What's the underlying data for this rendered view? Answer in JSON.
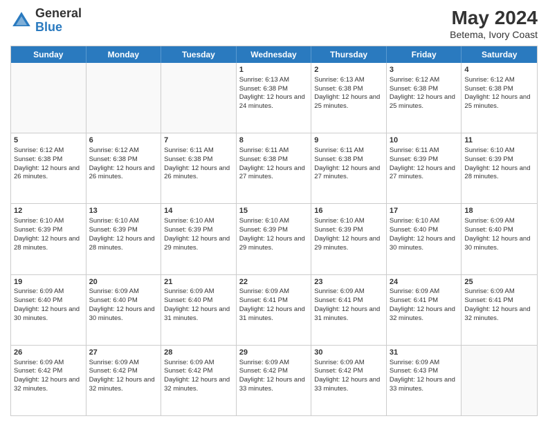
{
  "header": {
    "logo_general": "General",
    "logo_blue": "Blue",
    "month_title": "May 2024",
    "location": "Betema, Ivory Coast"
  },
  "days_of_week": [
    "Sunday",
    "Monday",
    "Tuesday",
    "Wednesday",
    "Thursday",
    "Friday",
    "Saturday"
  ],
  "weeks": [
    [
      {
        "day": "",
        "empty": true
      },
      {
        "day": "",
        "empty": true
      },
      {
        "day": "",
        "empty": true
      },
      {
        "day": "1",
        "sunrise": "Sunrise: 6:13 AM",
        "sunset": "Sunset: 6:38 PM",
        "daylight": "Daylight: 12 hours and 24 minutes."
      },
      {
        "day": "2",
        "sunrise": "Sunrise: 6:13 AM",
        "sunset": "Sunset: 6:38 PM",
        "daylight": "Daylight: 12 hours and 25 minutes."
      },
      {
        "day": "3",
        "sunrise": "Sunrise: 6:12 AM",
        "sunset": "Sunset: 6:38 PM",
        "daylight": "Daylight: 12 hours and 25 minutes."
      },
      {
        "day": "4",
        "sunrise": "Sunrise: 6:12 AM",
        "sunset": "Sunset: 6:38 PM",
        "daylight": "Daylight: 12 hours and 25 minutes."
      }
    ],
    [
      {
        "day": "5",
        "sunrise": "Sunrise: 6:12 AM",
        "sunset": "Sunset: 6:38 PM",
        "daylight": "Daylight: 12 hours and 26 minutes."
      },
      {
        "day": "6",
        "sunrise": "Sunrise: 6:12 AM",
        "sunset": "Sunset: 6:38 PM",
        "daylight": "Daylight: 12 hours and 26 minutes."
      },
      {
        "day": "7",
        "sunrise": "Sunrise: 6:11 AM",
        "sunset": "Sunset: 6:38 PM",
        "daylight": "Daylight: 12 hours and 26 minutes."
      },
      {
        "day": "8",
        "sunrise": "Sunrise: 6:11 AM",
        "sunset": "Sunset: 6:38 PM",
        "daylight": "Daylight: 12 hours and 27 minutes."
      },
      {
        "day": "9",
        "sunrise": "Sunrise: 6:11 AM",
        "sunset": "Sunset: 6:38 PM",
        "daylight": "Daylight: 12 hours and 27 minutes."
      },
      {
        "day": "10",
        "sunrise": "Sunrise: 6:11 AM",
        "sunset": "Sunset: 6:39 PM",
        "daylight": "Daylight: 12 hours and 27 minutes."
      },
      {
        "day": "11",
        "sunrise": "Sunrise: 6:10 AM",
        "sunset": "Sunset: 6:39 PM",
        "daylight": "Daylight: 12 hours and 28 minutes."
      }
    ],
    [
      {
        "day": "12",
        "sunrise": "Sunrise: 6:10 AM",
        "sunset": "Sunset: 6:39 PM",
        "daylight": "Daylight: 12 hours and 28 minutes."
      },
      {
        "day": "13",
        "sunrise": "Sunrise: 6:10 AM",
        "sunset": "Sunset: 6:39 PM",
        "daylight": "Daylight: 12 hours and 28 minutes."
      },
      {
        "day": "14",
        "sunrise": "Sunrise: 6:10 AM",
        "sunset": "Sunset: 6:39 PM",
        "daylight": "Daylight: 12 hours and 29 minutes."
      },
      {
        "day": "15",
        "sunrise": "Sunrise: 6:10 AM",
        "sunset": "Sunset: 6:39 PM",
        "daylight": "Daylight: 12 hours and 29 minutes."
      },
      {
        "day": "16",
        "sunrise": "Sunrise: 6:10 AM",
        "sunset": "Sunset: 6:39 PM",
        "daylight": "Daylight: 12 hours and 29 minutes."
      },
      {
        "day": "17",
        "sunrise": "Sunrise: 6:10 AM",
        "sunset": "Sunset: 6:40 PM",
        "daylight": "Daylight: 12 hours and 30 minutes."
      },
      {
        "day": "18",
        "sunrise": "Sunrise: 6:09 AM",
        "sunset": "Sunset: 6:40 PM",
        "daylight": "Daylight: 12 hours and 30 minutes."
      }
    ],
    [
      {
        "day": "19",
        "sunrise": "Sunrise: 6:09 AM",
        "sunset": "Sunset: 6:40 PM",
        "daylight": "Daylight: 12 hours and 30 minutes."
      },
      {
        "day": "20",
        "sunrise": "Sunrise: 6:09 AM",
        "sunset": "Sunset: 6:40 PM",
        "daylight": "Daylight: 12 hours and 30 minutes."
      },
      {
        "day": "21",
        "sunrise": "Sunrise: 6:09 AM",
        "sunset": "Sunset: 6:40 PM",
        "daylight": "Daylight: 12 hours and 31 minutes."
      },
      {
        "day": "22",
        "sunrise": "Sunrise: 6:09 AM",
        "sunset": "Sunset: 6:41 PM",
        "daylight": "Daylight: 12 hours and 31 minutes."
      },
      {
        "day": "23",
        "sunrise": "Sunrise: 6:09 AM",
        "sunset": "Sunset: 6:41 PM",
        "daylight": "Daylight: 12 hours and 31 minutes."
      },
      {
        "day": "24",
        "sunrise": "Sunrise: 6:09 AM",
        "sunset": "Sunset: 6:41 PM",
        "daylight": "Daylight: 12 hours and 32 minutes."
      },
      {
        "day": "25",
        "sunrise": "Sunrise: 6:09 AM",
        "sunset": "Sunset: 6:41 PM",
        "daylight": "Daylight: 12 hours and 32 minutes."
      }
    ],
    [
      {
        "day": "26",
        "sunrise": "Sunrise: 6:09 AM",
        "sunset": "Sunset: 6:42 PM",
        "daylight": "Daylight: 12 hours and 32 minutes."
      },
      {
        "day": "27",
        "sunrise": "Sunrise: 6:09 AM",
        "sunset": "Sunset: 6:42 PM",
        "daylight": "Daylight: 12 hours and 32 minutes."
      },
      {
        "day": "28",
        "sunrise": "Sunrise: 6:09 AM",
        "sunset": "Sunset: 6:42 PM",
        "daylight": "Daylight: 12 hours and 32 minutes."
      },
      {
        "day": "29",
        "sunrise": "Sunrise: 6:09 AM",
        "sunset": "Sunset: 6:42 PM",
        "daylight": "Daylight: 12 hours and 33 minutes."
      },
      {
        "day": "30",
        "sunrise": "Sunrise: 6:09 AM",
        "sunset": "Sunset: 6:42 PM",
        "daylight": "Daylight: 12 hours and 33 minutes."
      },
      {
        "day": "31",
        "sunrise": "Sunrise: 6:09 AM",
        "sunset": "Sunset: 6:43 PM",
        "daylight": "Daylight: 12 hours and 33 minutes."
      },
      {
        "day": "",
        "empty": true
      }
    ]
  ]
}
